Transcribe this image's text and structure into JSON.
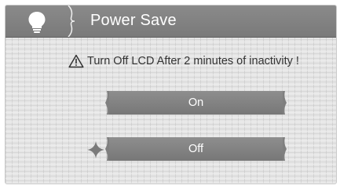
{
  "header": {
    "title": "Power Save",
    "icon": "lightbulb-icon"
  },
  "notice": {
    "icon": "warning-icon",
    "text": "Turn Off LCD After 2 minutes of inactivity !"
  },
  "options": [
    {
      "label": "On",
      "selected": false
    },
    {
      "label": "Off",
      "selected": true
    }
  ],
  "selection_marker": "four-point-star-icon",
  "colors": {
    "header_bg": "#7f7f7f",
    "button_bg": "#828282",
    "text_light": "#ffffff",
    "text_dark": "#333333"
  }
}
